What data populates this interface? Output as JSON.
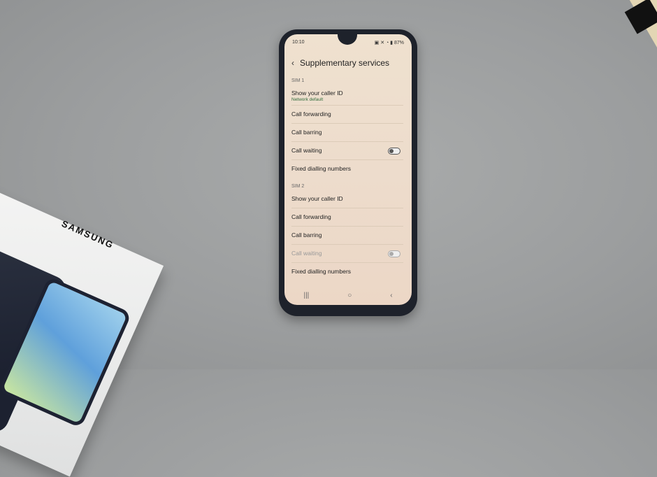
{
  "scene": {
    "box_brand": "SAMSUNG"
  },
  "status_bar": {
    "time": "10:10",
    "battery": "87%"
  },
  "header": {
    "back_icon": "chevron-left-icon",
    "title": "Supplementary services"
  },
  "sim1": {
    "label": "SIM 1",
    "items": [
      {
        "label": "Show your caller ID",
        "sub": "Network default"
      },
      {
        "label": "Call forwarding"
      },
      {
        "label": "Call barring"
      },
      {
        "label": "Call waiting",
        "toggle": false
      },
      {
        "label": "Fixed dialling numbers"
      }
    ]
  },
  "sim2": {
    "label": "SIM 2",
    "items": [
      {
        "label": "Show your caller ID"
      },
      {
        "label": "Call forwarding"
      },
      {
        "label": "Call barring"
      },
      {
        "label": "Call waiting",
        "toggle": false,
        "disabled": true
      },
      {
        "label": "Fixed dialling numbers"
      }
    ]
  },
  "nav_bar": {
    "recents": "|||",
    "home": "○",
    "back": "‹"
  }
}
